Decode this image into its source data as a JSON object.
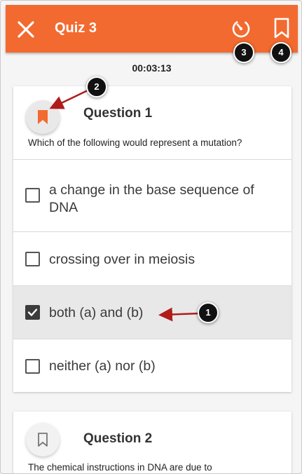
{
  "app_bar": {
    "title": "Quiz 3",
    "color": "#f26a30"
  },
  "timer": "00:03:13",
  "questions": [
    {
      "title": "Question 1",
      "text": "Which of the following would represent a mutation?",
      "flagged": true,
      "options": [
        {
          "label": "a change in the base sequence of DNA",
          "checked": false
        },
        {
          "label": "crossing over in meiosis",
          "checked": false
        },
        {
          "label": "both (a) and (b)",
          "checked": true
        },
        {
          "label": "neither (a) nor (b)",
          "checked": false
        }
      ]
    },
    {
      "title": "Question 2",
      "text": "The chemical instructions in DNA are due to",
      "flagged": false
    }
  ],
  "callouts": [
    "1",
    "2",
    "3",
    "4"
  ],
  "icons": {
    "close": "close-icon",
    "timer": "timer-icon",
    "bookmark": "bookmark-icon",
    "flag": "bookmark-filled-icon",
    "flag_outline": "bookmark-outline-icon"
  },
  "colors": {
    "accent": "#f26a30",
    "annotation_arrow": "#b01c1c"
  }
}
